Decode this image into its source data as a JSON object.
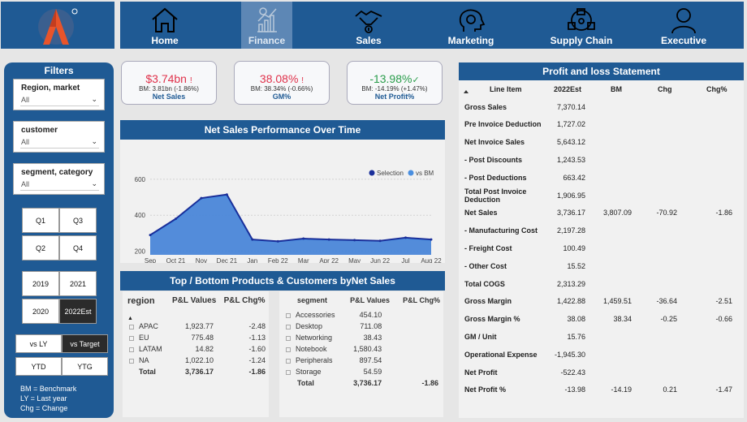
{
  "nav": {
    "items": [
      {
        "label": "Home",
        "icon": "home-icon"
      },
      {
        "label": "Finance",
        "icon": "finance-chart-icon",
        "active": true
      },
      {
        "label": "Sales",
        "icon": "handshake-icon"
      },
      {
        "label": "Marketing",
        "icon": "marketing-head-icon"
      },
      {
        "label": "Supply Chain",
        "icon": "supply-chain-icon"
      },
      {
        "label": "Executive",
        "icon": "user-icon"
      }
    ]
  },
  "filters": {
    "title": "Filters",
    "region": {
      "label": "Region, market",
      "value": "All"
    },
    "customer": {
      "label": "customer",
      "value": "All"
    },
    "segment": {
      "label": "segment, category",
      "value": "All"
    },
    "quarters": [
      "Q1",
      "Q3",
      "Q2",
      "Q4"
    ],
    "years": [
      "2019",
      "2021",
      "2020",
      "2022Est"
    ],
    "compare": [
      "vs LY",
      "vs Target"
    ],
    "period": [
      "YTD",
      "YTG"
    ],
    "legend": [
      "BM = Benchmark",
      "LY = Last year",
      "Chg = Change"
    ]
  },
  "kpis": [
    {
      "value": "$3.74bn",
      "flag": "!",
      "sub": "BM: 3.81bn (-1.86%)",
      "name": "Net Sales",
      "color": "#e0324b"
    },
    {
      "value": "38.08%",
      "flag": "!",
      "sub": "BM: 38.34% (-0.66%)",
      "name": "GM%",
      "color": "#e0324b"
    },
    {
      "value": "-13.98%",
      "flag": "✓",
      "sub": "BM: -14.19% (+1.47%)",
      "name": "Net Profit%",
      "color": "#2a9d4b"
    }
  ],
  "trend": {
    "title": "Net Sales Performance Over Time",
    "legend_selection": "Selection",
    "legend_bm": "vs BM"
  },
  "chart_data": {
    "type": "area",
    "title": "Net Sales Performance Over Time",
    "categories": [
      "Sep 21",
      "Oct 21",
      "Nov 21",
      "Dec 21",
      "Jan 22",
      "Feb 22",
      "Mar 22",
      "Apr 22",
      "May 22",
      "Jun 22",
      "Jul 22",
      "Aug 22"
    ],
    "series": [
      {
        "name": "Selection",
        "values": [
          290,
          380,
          495,
          515,
          265,
          255,
          270,
          265,
          262,
          258,
          275,
          265
        ],
        "color": "#1a2f9a"
      },
      {
        "name": "vs BM",
        "values": [
          285,
          370,
          490,
          505,
          260,
          252,
          265,
          262,
          260,
          255,
          270,
          260
        ],
        "color": "#4a8fe0"
      }
    ],
    "y_ticks": [
      200,
      400,
      600
    ],
    "ylim": [
      180,
      640
    ],
    "grid": true,
    "legend": "top-center"
  },
  "topbottom": {
    "title": "Top / Bottom Products & Customers byNet Sales",
    "region_table": {
      "headers": [
        "region",
        "P&L Values",
        "P&L Chg%"
      ],
      "rows": [
        [
          "APAC",
          "1,923.77",
          "-2.48"
        ],
        [
          "EU",
          "775.48",
          "-1.13"
        ],
        [
          "LATAM",
          "14.82",
          "-1.60"
        ],
        [
          "NA",
          "1,022.10",
          "-1.24"
        ]
      ],
      "total": [
        "Total",
        "3,736.17",
        "-1.86"
      ]
    },
    "segment_table": {
      "headers": [
        "segment",
        "P&L Values",
        "P&L Chg%"
      ],
      "rows": [
        [
          "Accessories",
          "454.10",
          ""
        ],
        [
          "Desktop",
          "711.08",
          ""
        ],
        [
          "Networking",
          "38.43",
          ""
        ],
        [
          "Notebook",
          "1,580.43",
          ""
        ],
        [
          "Peripherals",
          "897.54",
          ""
        ],
        [
          "Storage",
          "54.59",
          ""
        ]
      ],
      "total": [
        "Total",
        "3,736.17",
        "-1.86"
      ]
    }
  },
  "pl": {
    "title": "Profit and loss Statement",
    "headers": [
      "Line Item",
      "2022Est",
      "BM",
      "Chg",
      "Chg%"
    ],
    "rows": [
      [
        "Gross Sales",
        "7,370.14",
        "",
        "",
        ""
      ],
      [
        "Pre Invoice Deduction",
        "1,727.02",
        "",
        "",
        ""
      ],
      [
        "Net Invoice Sales",
        "5,643.12",
        "",
        "",
        ""
      ],
      [
        "- Post Discounts",
        "1,243.53",
        "",
        "",
        ""
      ],
      [
        "- Post Deductions",
        "663.42",
        "",
        "",
        ""
      ],
      [
        "Total Post Invoice Deduction",
        "1,906.95",
        "",
        "",
        ""
      ],
      [
        "Net Sales",
        "3,736.17",
        "3,807.09",
        "-70.92",
        "-1.86"
      ],
      [
        "- Manufacturing Cost",
        "2,197.28",
        "",
        "",
        ""
      ],
      [
        "- Freight Cost",
        "100.49",
        "",
        "",
        ""
      ],
      [
        "- Other Cost",
        "15.52",
        "",
        "",
        ""
      ],
      [
        "Total COGS",
        "2,313.29",
        "",
        "",
        ""
      ],
      [
        "Gross Margin",
        "1,422.88",
        "1,459.51",
        "-36.64",
        "-2.51"
      ],
      [
        "Gross Margin %",
        "38.08",
        "38.34",
        "-0.25",
        "-0.66"
      ],
      [
        "GM / Unit",
        "15.76",
        "",
        "",
        ""
      ],
      [
        "Operational Expense",
        "-1,945.30",
        "",
        "",
        ""
      ],
      [
        "Net Profit",
        "-522.43",
        "",
        "",
        ""
      ],
      [
        "Net Profit %",
        "-13.98",
        "-14.19",
        "0.21",
        "-1.47"
      ]
    ]
  }
}
